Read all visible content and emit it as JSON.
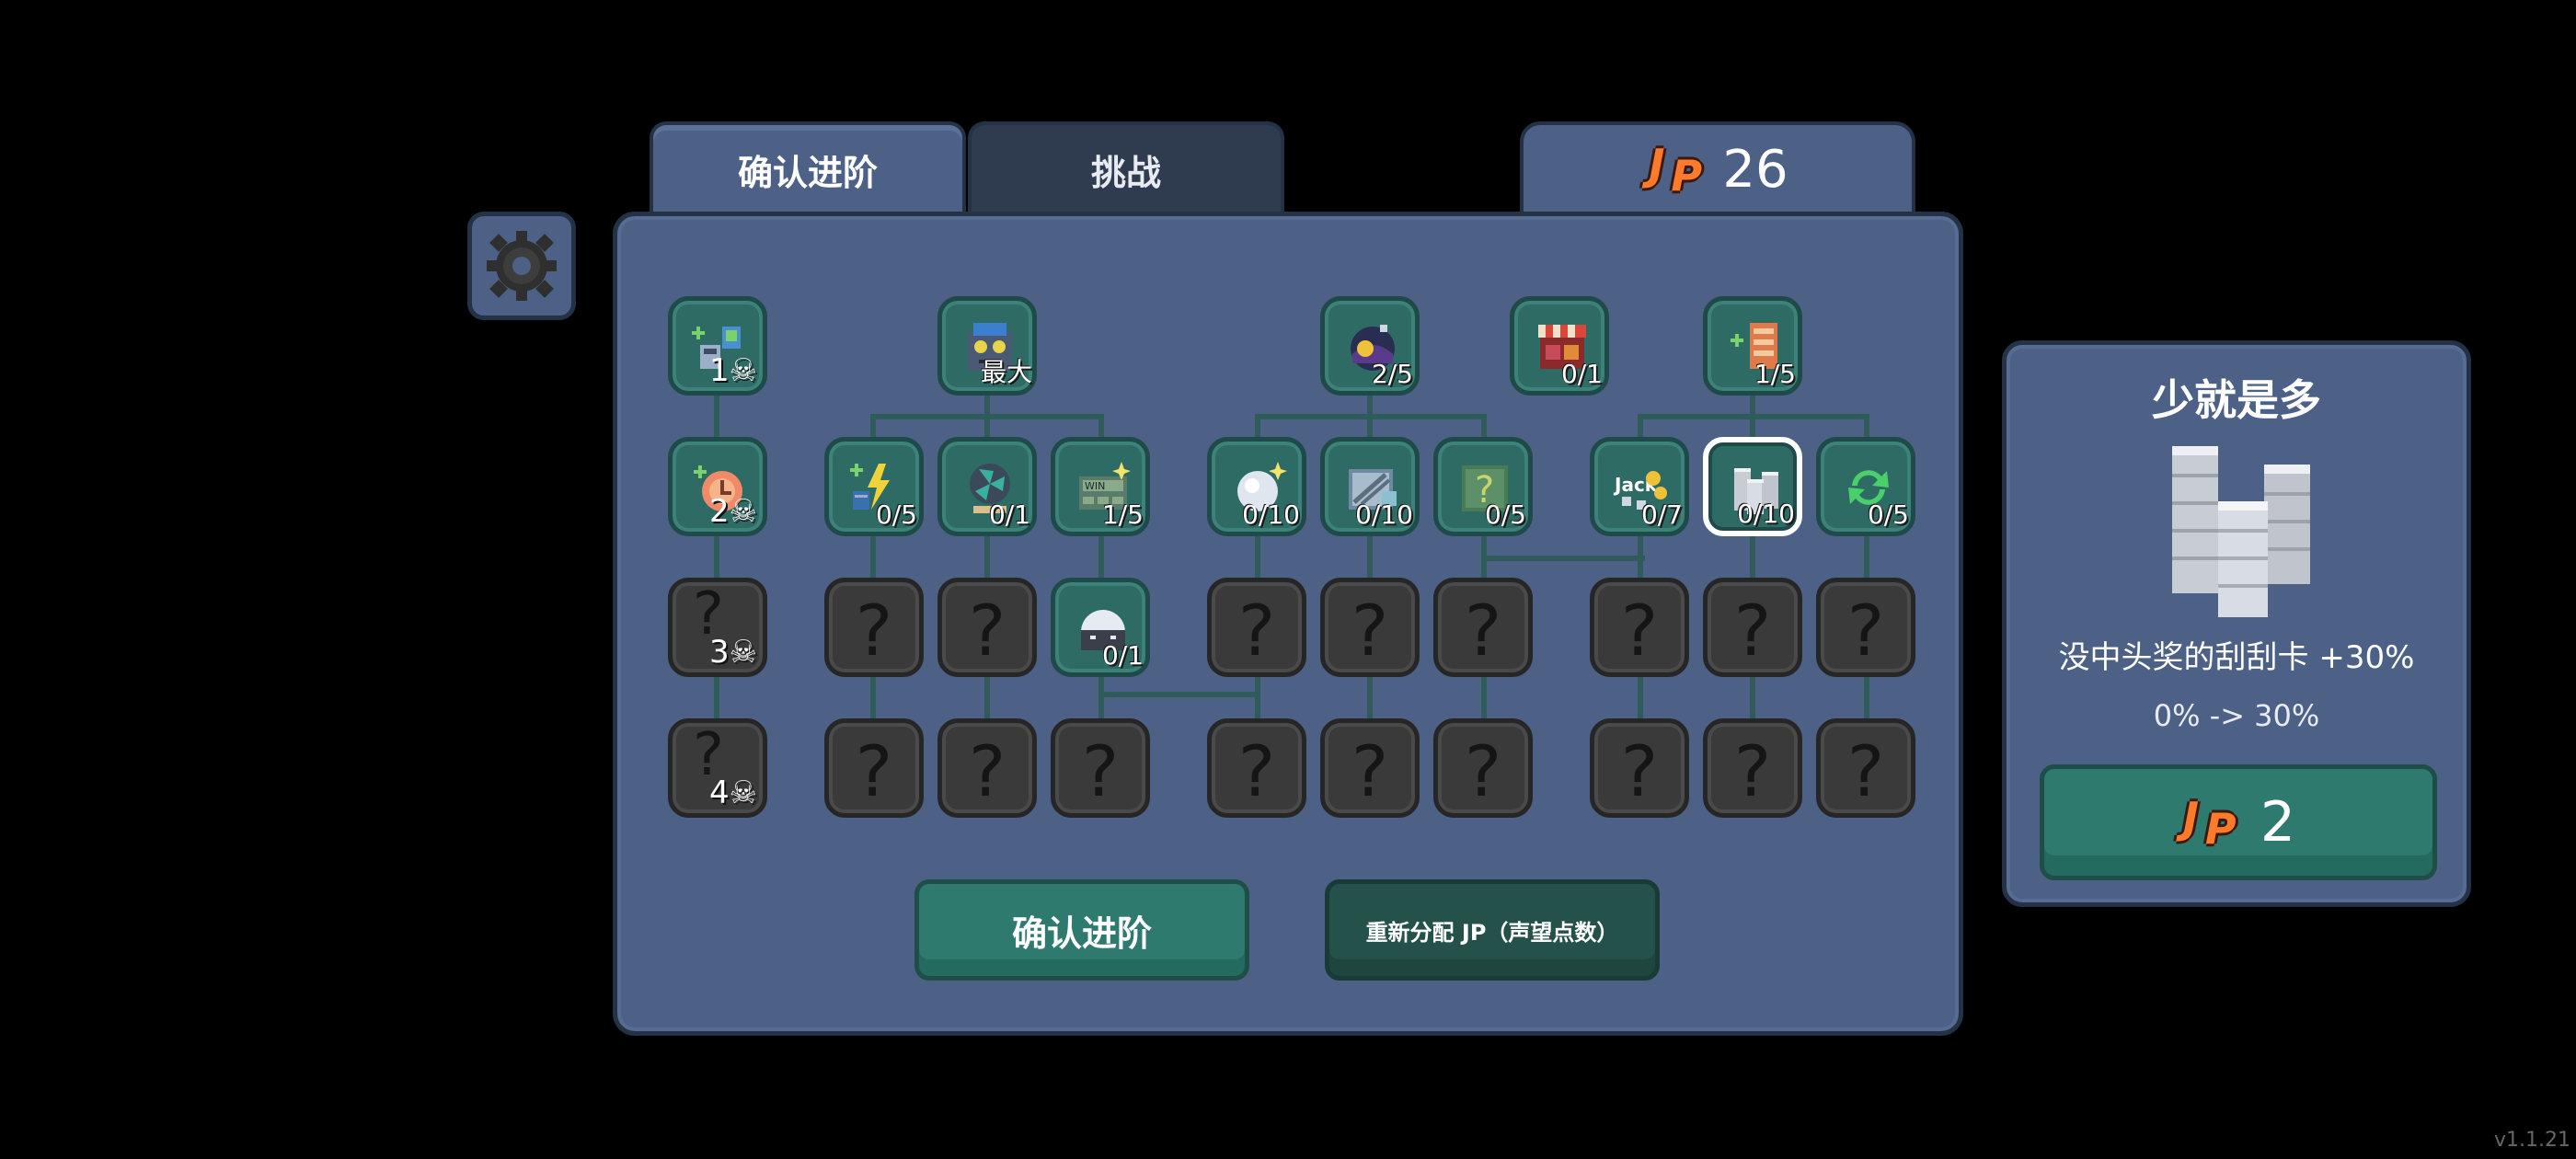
{
  "tabs": [
    {
      "label": "确认进阶",
      "active": true
    },
    {
      "label": "挑战",
      "active": false
    }
  ],
  "jp_balance": "26",
  "settings": {
    "icon": "gear-icon"
  },
  "tree": {
    "tier_labels": [
      "1",
      "2",
      "3",
      "4"
    ],
    "nodes_top": [
      {
        "label": "",
        "icon": "cards-plus-icon"
      },
      {
        "label": "最大",
        "icon": "robot-icon"
      },
      {
        "label": "2/5",
        "icon": "night-orb-icon"
      },
      {
        "label": "0/1",
        "icon": "shop-stall-icon"
      },
      {
        "label": "1/5",
        "icon": "plus-ticket-icon"
      }
    ],
    "nodes_row2": [
      {
        "label": "",
        "icon": "peach-clock-icon"
      },
      {
        "label": "0/5",
        "icon": "lightning-plus-icon"
      },
      {
        "label": "0/1",
        "icon": "fan-icon"
      },
      {
        "label": "1/5",
        "icon": "win-ticket-icon"
      },
      {
        "label": "0/10",
        "icon": "pearl-icon"
      },
      {
        "label": "0/10",
        "icon": "scratch-card-icon"
      },
      {
        "label": "0/5",
        "icon": "mystery-card-icon"
      },
      {
        "label": "0/7",
        "icon": "jackpot-icon"
      },
      {
        "label": "0/10",
        "icon": "coin-stack-icon"
      },
      {
        "label": "0/5",
        "icon": "recycle-icon"
      }
    ],
    "node_row3_unlocked": {
      "label": "0/1",
      "icon": "dome-bot-icon"
    },
    "locked_glyph": "?"
  },
  "buttons": {
    "confirm": "确认进阶",
    "redistribute": "重新分配 JP（声望点数）"
  },
  "detail": {
    "title": "少就是多",
    "icon": "coin-stack-icon",
    "description": "没中头奖的刮刮卡 +30%",
    "change": "0% -> 30%",
    "cost": "2"
  },
  "version": "v1.1.21",
  "colors": {
    "panel": "#4c6185",
    "node_unlocked": "#2e6b64",
    "node_locked": "#3a3a3a",
    "jp_orange": "#ff7a2a"
  }
}
